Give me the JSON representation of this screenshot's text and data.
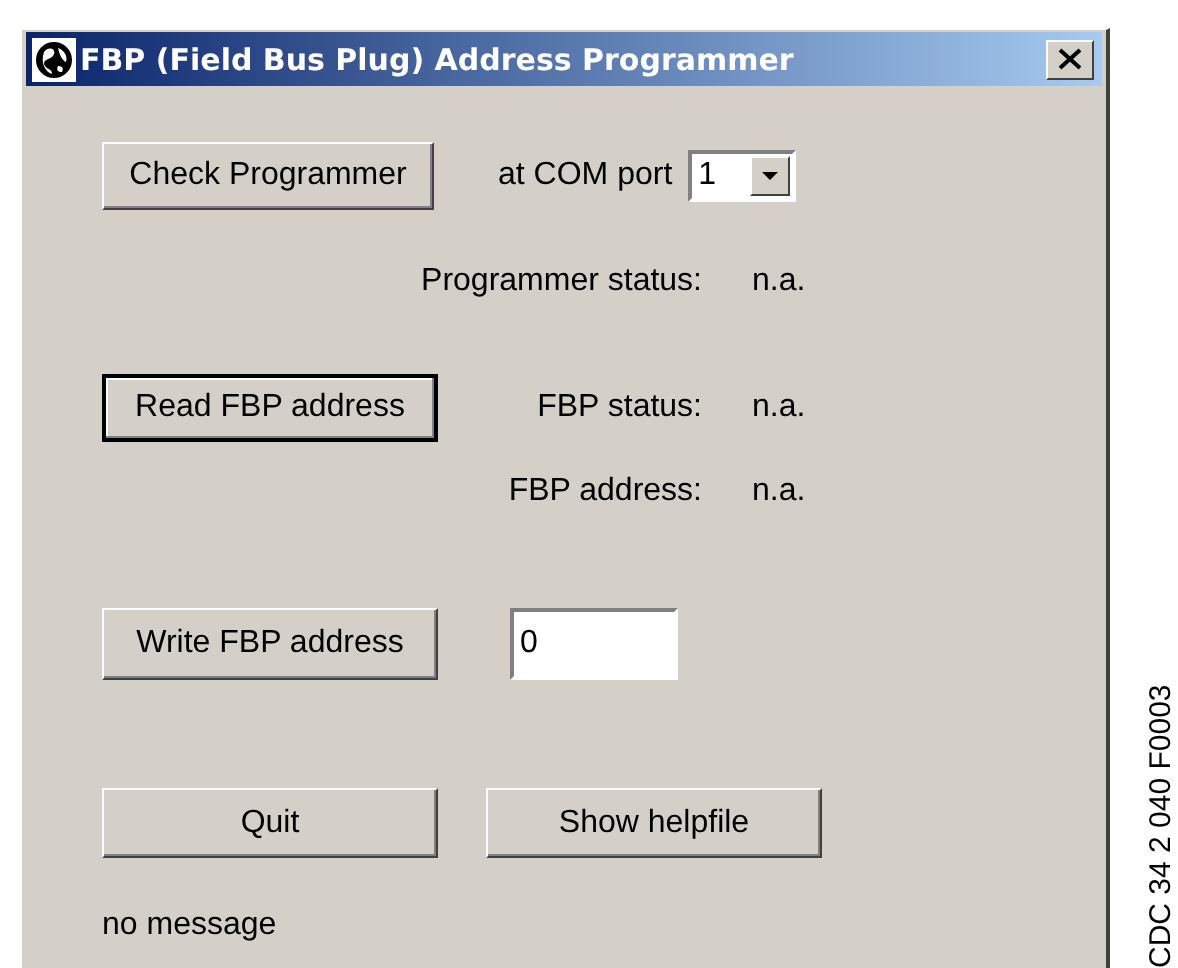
{
  "window": {
    "title": "FBP (Field Bus Plug) Address Programmer"
  },
  "check_button": {
    "label": "Check Programmer"
  },
  "com_port": {
    "label": "at COM port",
    "value": "1"
  },
  "programmer_status": {
    "label": "Programmer status:",
    "value": "n.a."
  },
  "read_button": {
    "label": "Read FBP address",
    "focused": true
  },
  "fbp_status": {
    "label": "FBP status:",
    "value": "n.a."
  },
  "fbp_address": {
    "label": "FBP address:",
    "value": "n.a."
  },
  "write_button": {
    "label": "Write FBP address"
  },
  "address_field": {
    "value": "0"
  },
  "buttons": [
    {
      "label": "Quit"
    },
    {
      "label": "Show helpfile"
    }
  ],
  "message": "no message",
  "side_caption": "CDC 34 2 040 F0003"
}
